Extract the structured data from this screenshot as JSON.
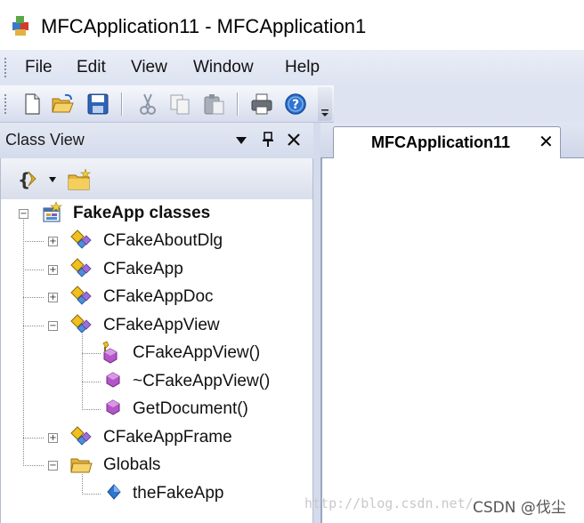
{
  "window": {
    "title": "MFCApplication11 - MFCApplication1",
    "icon": "mfc-app-icon"
  },
  "menu": {
    "items": [
      {
        "label": "File"
      },
      {
        "label": "Edit"
      },
      {
        "label": "View"
      },
      {
        "label": "Window"
      },
      {
        "label": "Help"
      }
    ]
  },
  "toolbar": {
    "buttons": [
      {
        "icon": "new-document-icon"
      },
      {
        "icon": "open-folder-icon"
      },
      {
        "icon": "save-icon"
      },
      {
        "icon": "cut-icon"
      },
      {
        "icon": "copy-icon"
      },
      {
        "icon": "paste-icon"
      },
      {
        "icon": "print-icon"
      },
      {
        "icon": "help-icon"
      }
    ],
    "overflow_icon": "toolbar-overflow-icon"
  },
  "class_view": {
    "title": "Class View",
    "controls": {
      "dropdown": "▼",
      "pin": "📌",
      "close": "✕"
    },
    "toolbar_icons": [
      "sort-icon",
      "dropdown-arrow-icon",
      "new-folder-icon"
    ],
    "tree": {
      "root": "FakeApp classes",
      "items": [
        {
          "label": "CFakeAboutDlg",
          "expander": "+"
        },
        {
          "label": "CFakeApp",
          "expander": "+"
        },
        {
          "label": "CFakeAppDoc",
          "expander": "+"
        },
        {
          "label": "CFakeAppView",
          "expander": "−"
        },
        {
          "label": "CFakeAppView()"
        },
        {
          "label": "~CFakeAppView()"
        },
        {
          "label": "GetDocument()"
        },
        {
          "label": "CFakeAppFrame",
          "expander": "+"
        },
        {
          "label": "Globals",
          "expander": "−"
        },
        {
          "label": "theFakeApp"
        }
      ],
      "root_expander": "−"
    }
  },
  "document": {
    "tab_label": "MFCApplication11",
    "close_label": "✕"
  },
  "watermark": {
    "url": "http://blog.csdn.net/",
    "brand": "CSDN @伐尘"
  },
  "colors": {
    "chrome_blue": "#dde3f1",
    "method_purple": "#b455c8",
    "class_yellow": "#e8b820"
  }
}
